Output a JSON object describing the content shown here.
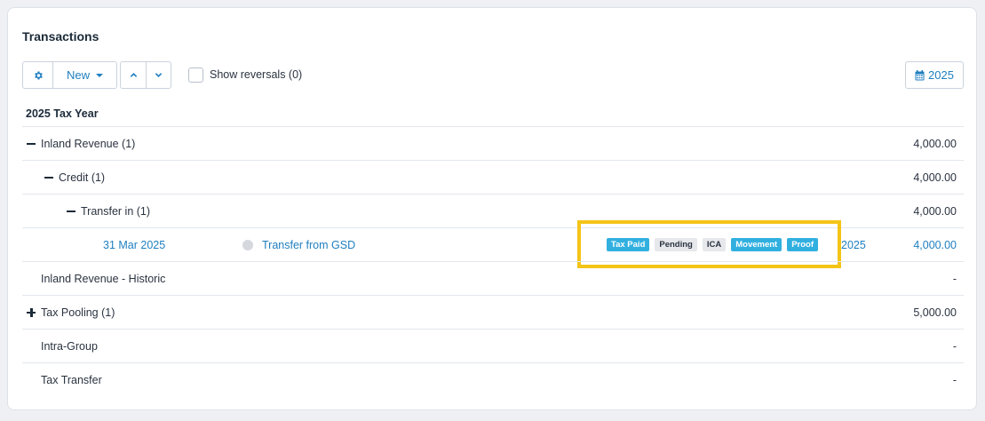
{
  "card": {
    "title": "Transactions"
  },
  "toolbar": {
    "settings_icon": "gear-icon",
    "new_label": "New",
    "up_icon": "chevron-up-icon",
    "down_icon": "chevron-down-icon",
    "show_reversals_label": "Show reversals (0)",
    "show_reversals_checked": false,
    "year_label": "2025",
    "year_icon": "calendar-icon"
  },
  "section_title": "2025 Tax Year",
  "rows": [
    {
      "label": "Inland Revenue (1)",
      "amount": "4,000.00",
      "toggle": "minus"
    },
    {
      "label": "Credit (1)",
      "amount": "4,000.00",
      "toggle": "minus"
    },
    {
      "label": "Transfer in (1)",
      "amount": "4,000.00",
      "toggle": "minus"
    },
    {
      "date": "31 Mar 2025",
      "description": "Transfer from GSD",
      "tags": [
        {
          "label": "Tax Paid",
          "color": "#31b0e0"
        },
        {
          "label": "Pending",
          "color": "#e6e8eb"
        },
        {
          "label": "ICA",
          "color": "#e6e8eb"
        },
        {
          "label": "Movement",
          "color": "#31b0e0"
        },
        {
          "label": "Proof",
          "color": "#31b0e0"
        }
      ],
      "year": "2025",
      "amount": "4,000.00",
      "highlight_color": "#f4c417"
    },
    {
      "label": "Inland Revenue - Historic",
      "amount": "-"
    },
    {
      "label": "Tax Pooling (1)",
      "amount": "5,000.00",
      "toggle": "plus"
    },
    {
      "label": "Intra-Group",
      "amount": "-"
    },
    {
      "label": "Tax Transfer",
      "amount": "-"
    }
  ],
  "colors": {
    "accent": "#1f7fc0",
    "tag_blue": "#31b0e0",
    "highlight": "#f4c417"
  }
}
